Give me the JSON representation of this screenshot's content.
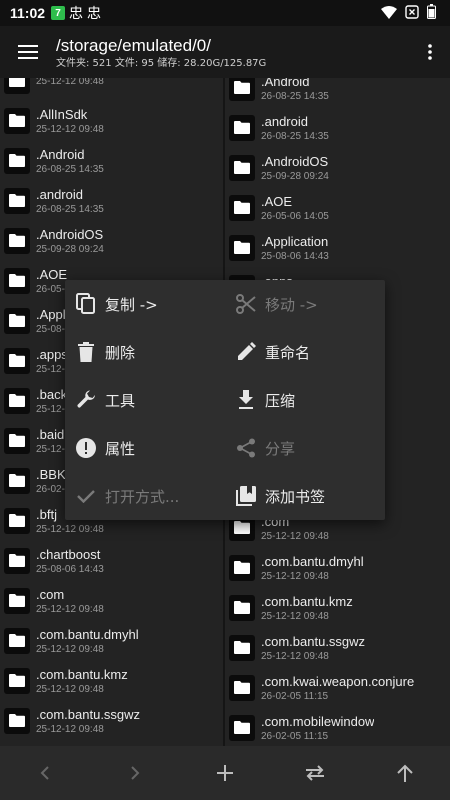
{
  "status": {
    "time": "11:02",
    "notif_badge": "7",
    "notif_glyphs": [
      "忠",
      "忠"
    ],
    "icons": [
      "wifi-icon",
      "battery-x-icon",
      "battery-icon"
    ]
  },
  "toolbar": {
    "path": "/storage/emulated/0/",
    "info": "文件夹: 521  文件: 95  储存: 28.20G/125.87G"
  },
  "left_pane": {
    "items": [
      {
        "name": "",
        "date": "25-12-12 09:48"
      },
      {
        "name": ".AllInSdk",
        "date": "25-12-12 09:48"
      },
      {
        "name": ".Android",
        "date": "26-08-25 14:35"
      },
      {
        "name": ".android",
        "date": "26-08-25 14:35"
      },
      {
        "name": ".AndroidOS",
        "date": "25-09-28 09:24"
      },
      {
        "name": ".AOE",
        "date": "26-05-06 14:05"
      },
      {
        "name": ".Application",
        "date": "25-08-06 14:43"
      },
      {
        "name": ".apps",
        "date": "25-12-12 09:48"
      },
      {
        "name": ".backups",
        "date": "25-12-12 09:48"
      },
      {
        "name": ".baidu",
        "date": "25-12-12 09:48"
      },
      {
        "name": ".BBK",
        "date": "26-02-05 11:15"
      },
      {
        "name": ".bftj",
        "date": "25-12-12 09:48"
      },
      {
        "name": ".chartboost",
        "date": "25-08-06 14:43"
      },
      {
        "name": ".com",
        "date": "25-12-12 09:48"
      },
      {
        "name": ".com.bantu.dmyhl",
        "date": "25-12-12 09:48"
      },
      {
        "name": ".com.bantu.kmz",
        "date": "25-12-12 09:48"
      },
      {
        "name": ".com.bantu.ssgwz",
        "date": "25-12-12 09:48"
      },
      {
        "name": ".com.kwai.weapon.conjure",
        "date": ""
      }
    ]
  },
  "right_pane": {
    "items": [
      {
        "name": ".Android",
        "date": "26-08-25 14:35"
      },
      {
        "name": ".android",
        "date": "26-08-25 14:35"
      },
      {
        "name": ".AndroidOS",
        "date": "25-09-28 09:24"
      },
      {
        "name": ".AOE",
        "date": "26-05-06 14:05"
      },
      {
        "name": ".Application",
        "date": "25-08-06 14:43"
      },
      {
        "name": ".apps",
        "date": "25-12-12 09:48"
      },
      {
        "name": ".backups",
        "date": "25-12-12 09:48"
      },
      {
        "name": ".baidu",
        "date": "25-12-12 09:48"
      },
      {
        "name": ".BBK",
        "date": "26-02-05 11:15"
      },
      {
        "name": ".bftj",
        "date": "25-12-12 09:48"
      },
      {
        "name": ".chartboost",
        "date": "25-08-06 14:43"
      },
      {
        "name": ".com",
        "date": "25-12-12 09:48"
      },
      {
        "name": ".com.bantu.dmyhl",
        "date": "25-12-12 09:48"
      },
      {
        "name": ".com.bantu.kmz",
        "date": "25-12-12 09:48"
      },
      {
        "name": ".com.bantu.ssgwz",
        "date": "25-12-12 09:48"
      },
      {
        "name": ".com.kwai.weapon.conjure",
        "date": "26-02-05 11:15"
      },
      {
        "name": ".com.mobilewindow",
        "date": "26-02-05 11:15"
      }
    ]
  },
  "context_menu": {
    "copy": "复制 ->",
    "move": "移动 ->",
    "delete": "删除",
    "rename": "重命名",
    "tools": "工具",
    "compress": "压缩",
    "properties": "属性",
    "share": "分享",
    "open_with": "打开方式...",
    "add_bookmark": "添加书签"
  },
  "bottom_bar": {
    "icons": [
      "back-arrow-icon",
      "forward-arrow-icon",
      "add-icon",
      "swap-icon",
      "up-arrow-icon"
    ]
  },
  "colors": {
    "background": "#232323",
    "toolbar": "#1a1a1a",
    "menu": "#2e2e2e",
    "notif_green": "#2ebd4c"
  }
}
